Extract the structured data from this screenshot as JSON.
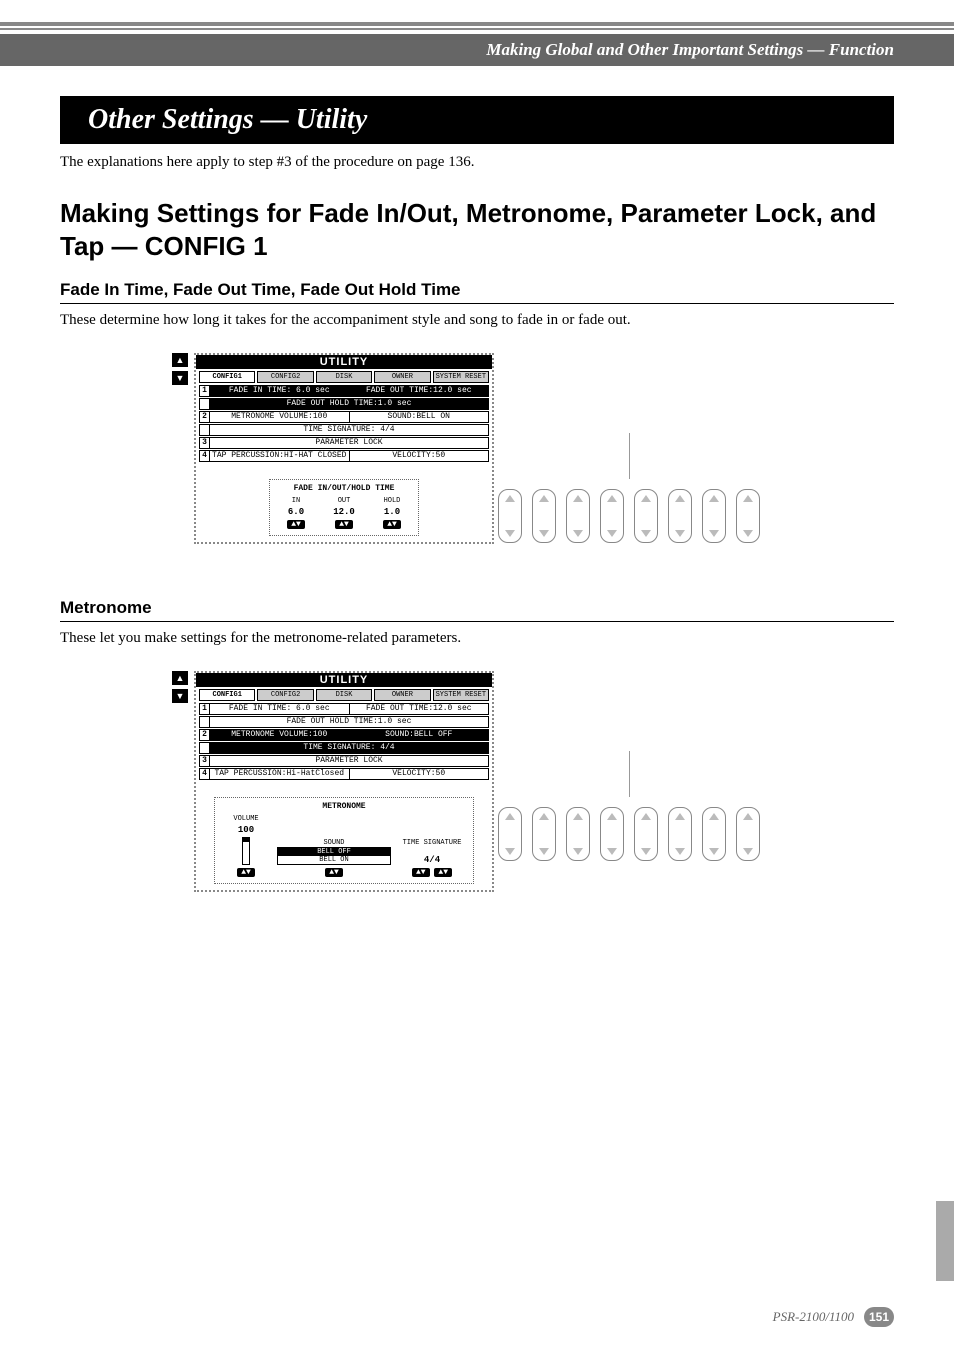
{
  "breadcrumb": "Making Global and Other Important Settings — Function",
  "section_title": "Other Settings — Utility",
  "intro": "The explanations here apply to step #3 of the procedure on page 136.",
  "h2": "Making Settings for Fade In/Out, Metronome, Parameter Lock, and Tap — CONFIG 1",
  "sub1": {
    "heading": "Fade In Time, Fade Out Time, Fade Out Hold Time",
    "text": "These determine how long it takes for the accompaniment style and song to fade in or fade out."
  },
  "sub2": {
    "heading": "Metronome",
    "text": "These let you make settings for the metronome-related parameters."
  },
  "lcd": {
    "title": "UTILITY",
    "tabs": [
      "CONFIG1",
      "CONFIG2",
      "DISK",
      "OWNER",
      "SYSTEM RESET"
    ],
    "rows": {
      "r1a": "FADE IN TIME: 6.0 sec",
      "r1b": "FADE OUT TIME:12.0 sec",
      "r1c": "FADE OUT HOLD TIME:1.0 sec",
      "r2a": "METRONOME VOLUME:100",
      "r2b_on": "SOUND:BELL ON",
      "r2b_off": "SOUND:BELL OFF",
      "r2c": "TIME SIGNATURE:  4/4",
      "r3": "PARAMETER LOCK",
      "r4a": "TAP PERCUSSION:HI-HAT CLOSED",
      "r4a_alt": "TAP PERCUSSION:Hi-HatClosed",
      "r4b": "VELOCITY:50"
    }
  },
  "lower_fade": {
    "group_label": "FADE IN/OUT/HOLD TIME",
    "cols": [
      {
        "sub": "IN",
        "val": "6.0"
      },
      {
        "sub": "OUT",
        "val": "12.0"
      },
      {
        "sub": "HOLD",
        "val": "1.0"
      }
    ]
  },
  "lower_metro": {
    "group_label": "METRONOME",
    "vol_label": "VOLUME",
    "vol_value": "100",
    "sound_label": "SOUND",
    "sound_options": [
      "BELL OFF",
      "BELL ON"
    ],
    "sig_label": "TIME SIGNATURE",
    "sig_value": "4/4"
  },
  "footer": {
    "model": "PSR-2100/1100",
    "page": "151"
  }
}
